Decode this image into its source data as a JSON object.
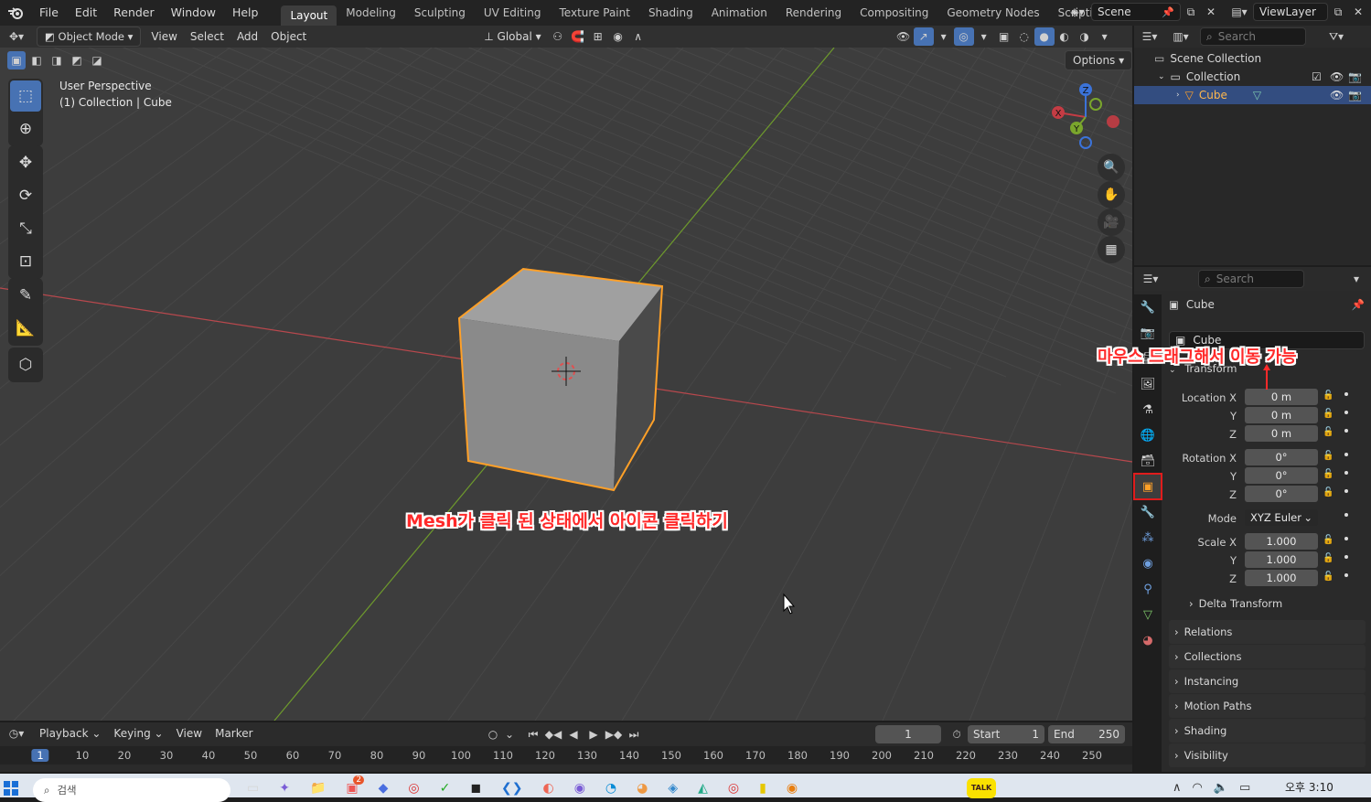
{
  "topbar": {
    "menus": [
      "File",
      "Edit",
      "Render",
      "Window",
      "Help"
    ],
    "workspaces": [
      "Layout",
      "Modeling",
      "Sculpting",
      "UV Editing",
      "Texture Paint",
      "Shading",
      "Animation",
      "Rendering",
      "Compositing",
      "Geometry Nodes",
      "Scripting"
    ],
    "active_workspace": "Layout",
    "add_workspace": "+",
    "scene": "Scene",
    "view_layer": "ViewLayer"
  },
  "viewport": {
    "mode": "Object Mode",
    "menus": [
      "View",
      "Select",
      "Add",
      "Object"
    ],
    "orientation": "Global",
    "options_label": "Options",
    "overlay_line1": "User Perspective",
    "overlay_line2": "(1) Collection | Cube",
    "gizmo": {
      "x": "X",
      "y": "Y",
      "z": "Z"
    },
    "annotation_center": "Mesh가 클릭 된 상태에서 아이콘 클릭하기"
  },
  "outliner": {
    "search_placeholder": "Search",
    "scene_collection": "Scene Collection",
    "collection": "Collection",
    "object": "Cube"
  },
  "properties": {
    "search_placeholder": "Search",
    "object_name": "Cube",
    "data_name": "Cube",
    "annotation": "마우스 드래그해서 이동 가능",
    "transform_label": "Transform",
    "location": {
      "label_x": "Location X",
      "label_y": "Y",
      "label_z": "Z",
      "x": "0 m",
      "y": "0 m",
      "z": "0 m"
    },
    "rotation": {
      "label_x": "Rotation X",
      "label_y": "Y",
      "label_z": "Z",
      "x": "0°",
      "y": "0°",
      "z": "0°"
    },
    "mode": {
      "label": "Mode",
      "value": "XYZ Euler"
    },
    "scale": {
      "label_x": "Scale X",
      "label_y": "Y",
      "label_z": "Z",
      "x": "1.000",
      "y": "1.000",
      "z": "1.000"
    },
    "delta_transform": "Delta Transform",
    "panels": [
      "Relations",
      "Collections",
      "Instancing",
      "Motion Paths",
      "Shading",
      "Visibility"
    ]
  },
  "timeline": {
    "menus": [
      "Playback",
      "Keying",
      "View",
      "Marker"
    ],
    "current_frame": "1",
    "start_label": "Start",
    "start": "1",
    "end_label": "End",
    "end": "250",
    "ruler": [
      "1",
      "10",
      "20",
      "30",
      "40",
      "50",
      "60",
      "70",
      "80",
      "90",
      "100",
      "110",
      "120",
      "130",
      "140",
      "150",
      "160",
      "170",
      "180",
      "190",
      "200",
      "210",
      "220",
      "230",
      "240",
      "250"
    ]
  },
  "taskbar": {
    "search_placeholder": "검색",
    "badge": "2",
    "kakao": "TALK",
    "clock": "오후 3:10"
  },
  "colors": {
    "accent": "#4772b3",
    "selection": "#ffa028",
    "x_axis": "#c43c44",
    "y_axis": "#7aa62c",
    "annotation": "#ff2a2a"
  }
}
